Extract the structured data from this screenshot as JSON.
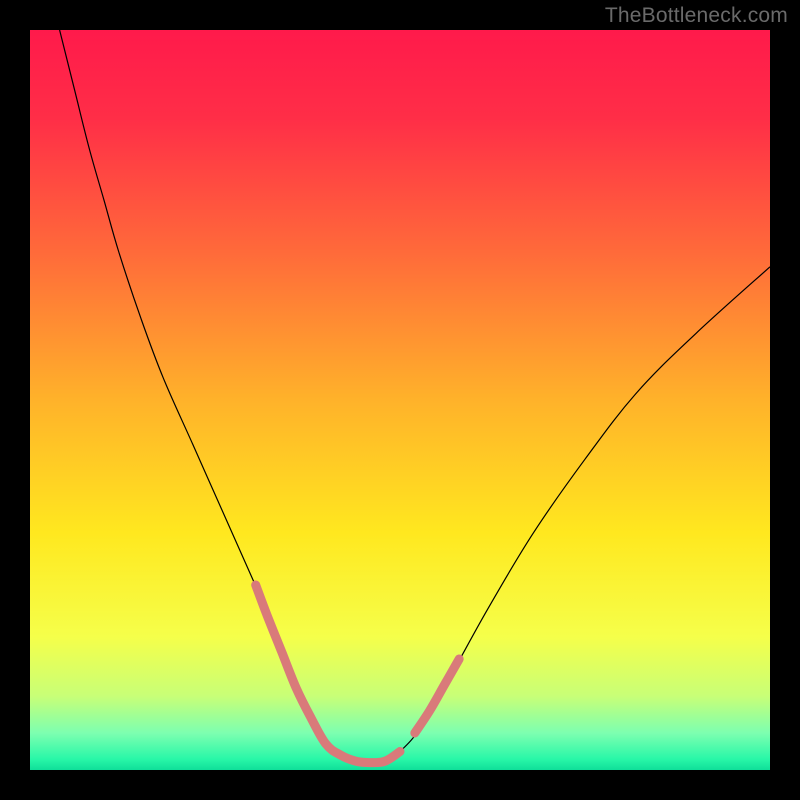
{
  "watermark": {
    "text": "TheBottleneck.com"
  },
  "chart_data": {
    "type": "line",
    "title": "",
    "xlabel": "",
    "ylabel": "",
    "xlim": [
      0,
      100
    ],
    "ylim": [
      0,
      100
    ],
    "grid": false,
    "legend": false,
    "background_gradient_stops": [
      {
        "offset": 0.0,
        "color": "#ff1a4b"
      },
      {
        "offset": 0.12,
        "color": "#ff2e47"
      },
      {
        "offset": 0.3,
        "color": "#ff6a3a"
      },
      {
        "offset": 0.5,
        "color": "#ffb22a"
      },
      {
        "offset": 0.68,
        "color": "#ffe81f"
      },
      {
        "offset": 0.82,
        "color": "#f5ff4a"
      },
      {
        "offset": 0.9,
        "color": "#c8ff77"
      },
      {
        "offset": 0.95,
        "color": "#7dffb0"
      },
      {
        "offset": 0.985,
        "color": "#29f7a8"
      },
      {
        "offset": 1.0,
        "color": "#0fdf99"
      }
    ],
    "series": [
      {
        "name": "main-curve",
        "color": "#000000",
        "width": 1.2,
        "x": [
          4,
          6,
          8,
          10,
          12,
          15,
          18,
          22,
          26,
          30,
          33,
          35,
          37,
          39,
          40.5,
          42,
          44,
          46,
          48,
          50,
          53,
          57,
          62,
          68,
          75,
          82,
          90,
          100
        ],
        "y": [
          100,
          92,
          84,
          77,
          70,
          61,
          53,
          44,
          35,
          26,
          19,
          14,
          10,
          6,
          3.5,
          2,
          1.2,
          1.0,
          1.2,
          2.5,
          6,
          13,
          22,
          32,
          42,
          51,
          59,
          68
        ]
      },
      {
        "name": "highlight-valley",
        "color": "#d97a7a",
        "width": 9,
        "linecap": "round",
        "x": [
          30.5,
          32,
          34,
          36,
          38,
          40,
          42,
          44,
          46,
          48,
          50
        ],
        "y": [
          25,
          21,
          16,
          11,
          7,
          3.5,
          2,
          1.2,
          1.0,
          1.2,
          2.5
        ]
      },
      {
        "name": "highlight-right",
        "color": "#d97a7a",
        "width": 9,
        "linecap": "round",
        "x": [
          52,
          54,
          56,
          58
        ],
        "y": [
          5,
          8,
          11.5,
          15
        ]
      }
    ],
    "annotations": []
  }
}
